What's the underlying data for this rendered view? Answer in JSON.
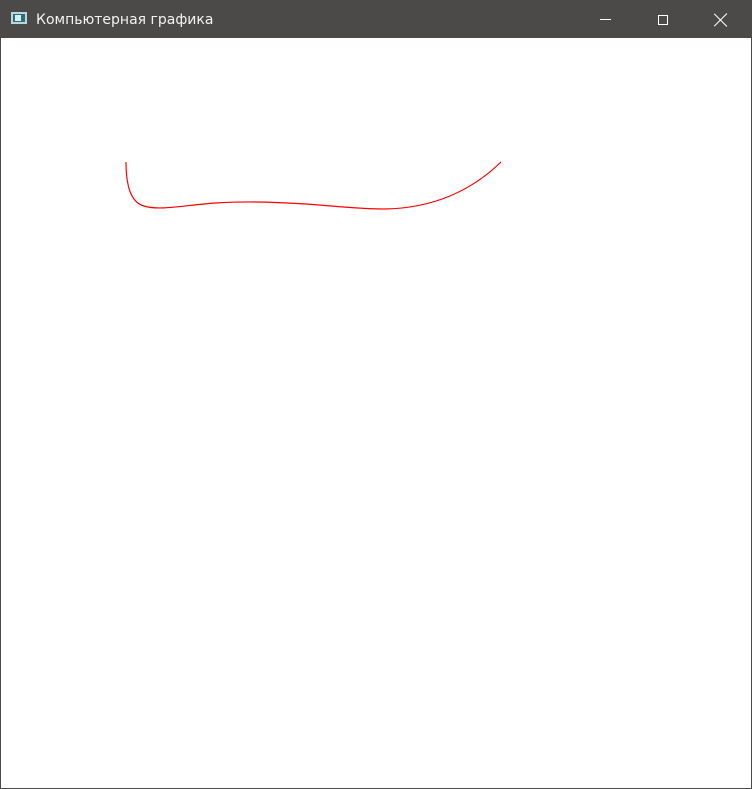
{
  "window": {
    "title": "Компьютерная графика",
    "curve_color": "#ff0000",
    "icons": {
      "app": "app-window-icon",
      "minimize": "minimize-icon",
      "maximize": "maximize-icon",
      "close": "close-icon"
    }
  }
}
